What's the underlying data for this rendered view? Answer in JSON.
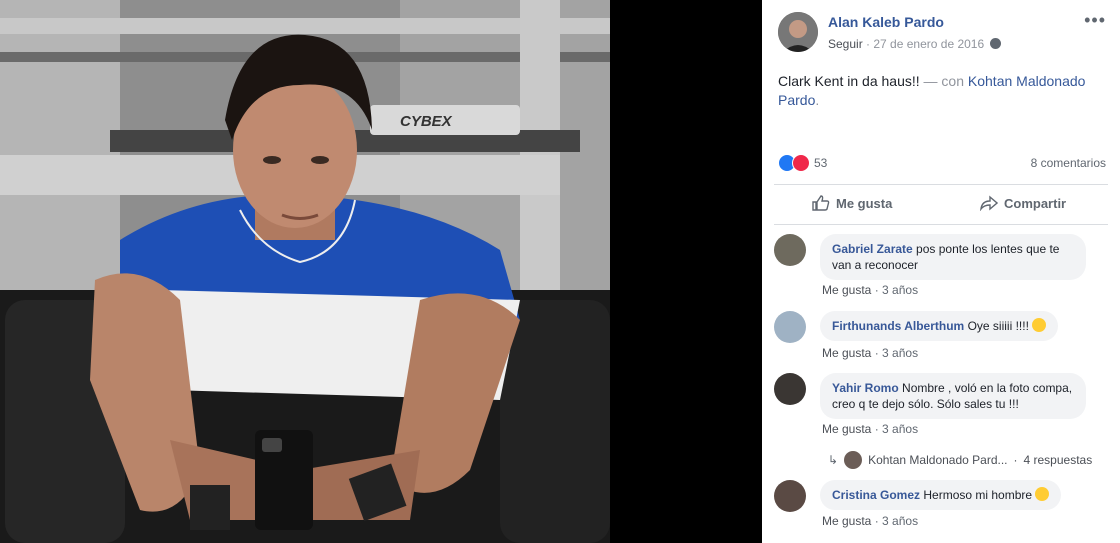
{
  "post": {
    "author": "Alan Kaleb Pardo",
    "follow_label": "Seguir",
    "separator": "·",
    "date": "27 de enero de 2016",
    "more_label": "•••",
    "text": "Clark Kent in da haus!!",
    "with_label": "— con",
    "tagged": "Kohtan Maldonado Pardo",
    "tagged_end": ".",
    "reaction_count": "53",
    "comments_count": "8 comentarios",
    "like_label": "Me gusta",
    "share_label": "Compartir"
  },
  "photo": {
    "brand_text": "CYBEX"
  },
  "comments": [
    {
      "author": "Gabriel Zarate",
      "text": "pos ponte los lentes que te van a reconocer",
      "like_label": "Me gusta",
      "sep": "·",
      "time": "3 años"
    },
    {
      "author": "Firthunands Alberthum",
      "text": "Oye siiiii !!!!",
      "like_label": "Me gusta",
      "sep": "·",
      "time": "3 años"
    },
    {
      "author": "Yahir Romo",
      "text": "Nombre , voló en la foto compa, creo q te dejo sólo. Sólo sales tu !!!",
      "like_label": "Me gusta",
      "sep": "·",
      "time": "3 años"
    },
    {
      "author": "Cristina Gomez",
      "text": "Hermoso mi hombre",
      "like_label": "Me gusta",
      "sep": "·",
      "time": "3 años"
    }
  ],
  "reply": {
    "author": "Kohtan Maldonado Pard...",
    "sep": "·",
    "count": "4 respuestas"
  },
  "colors": {
    "link": "#365899",
    "muted": "#90949c",
    "bubble": "#f2f3f5",
    "like_blue": "#2078f4",
    "love_red": "#f0284a"
  }
}
